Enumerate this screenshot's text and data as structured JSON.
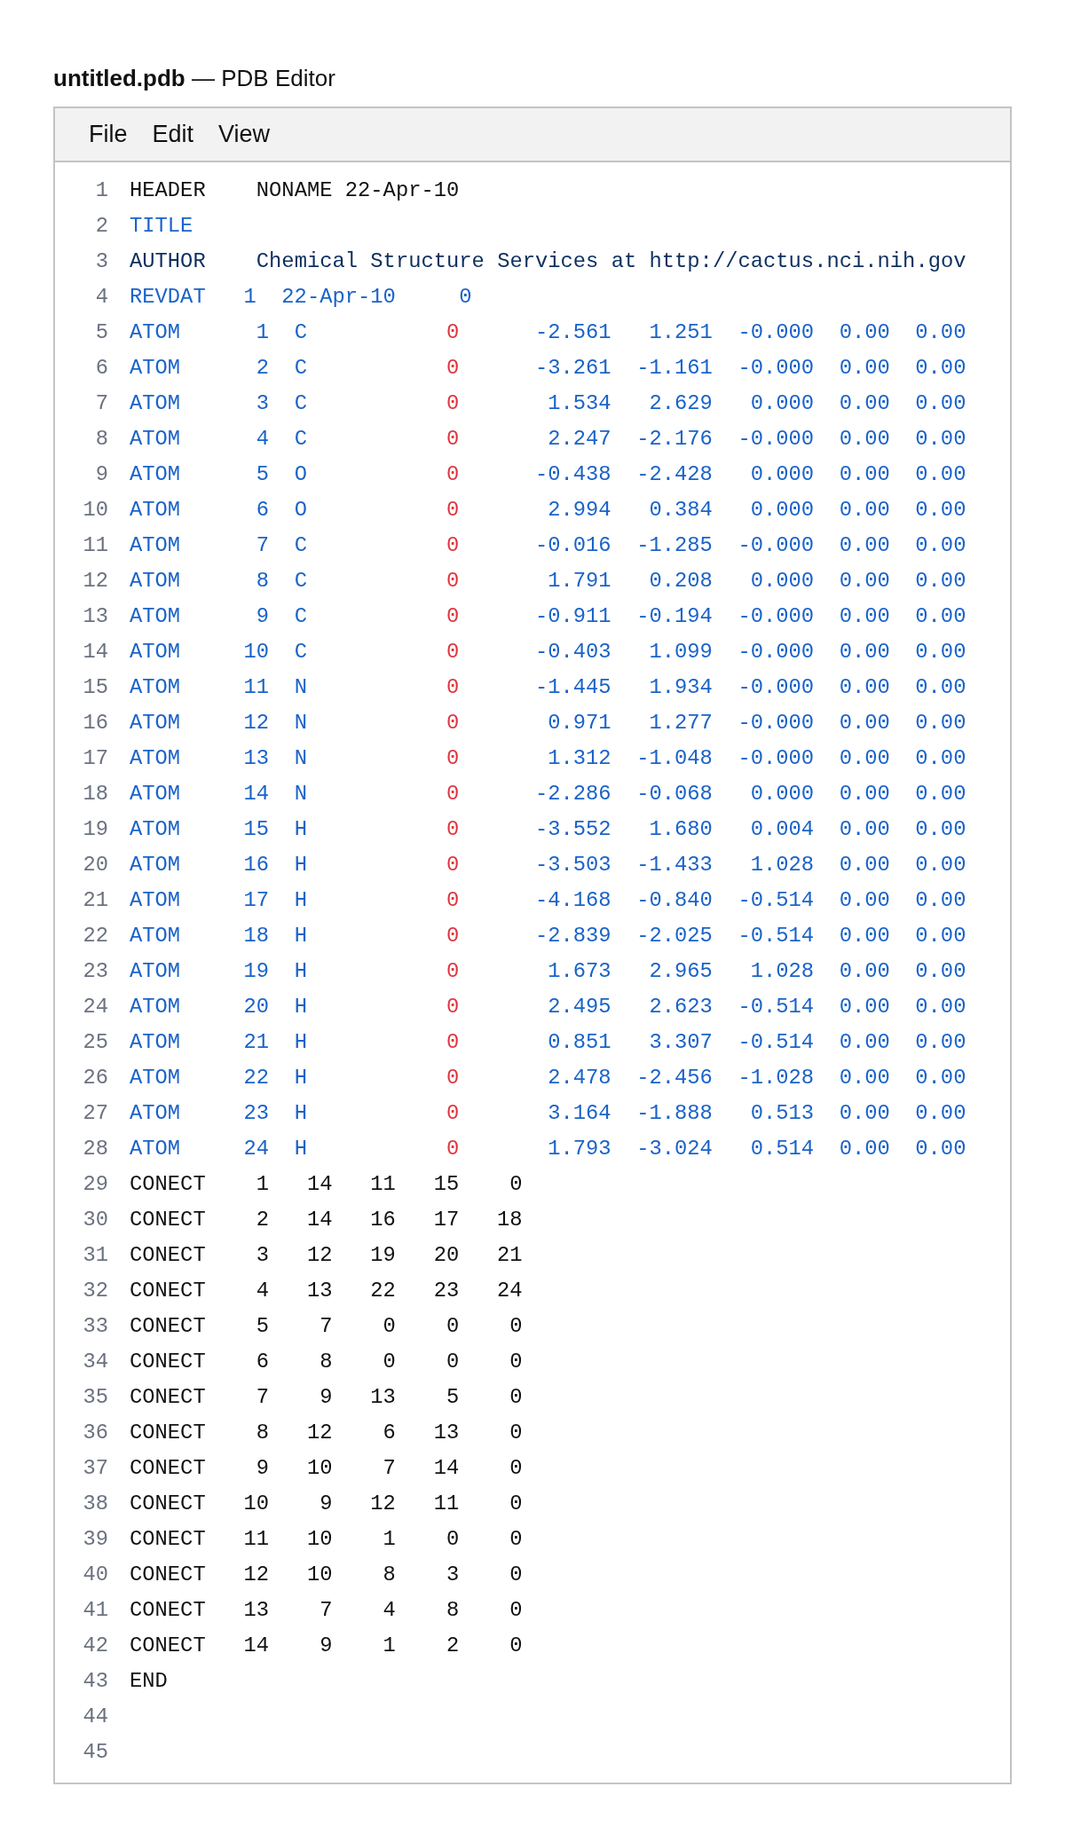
{
  "window": {
    "title": "**untitled.pdb** — PDB Editor"
  },
  "menu": [
    "File",
    "Edit",
    "View"
  ],
  "lines": [
    {
      "number": "1",
      "kind": "header",
      "fields": [
        "HEADER",
        "NONAME 22-Apr-10"
      ]
    },
    {
      "number": "2",
      "kind": "title",
      "fields": [
        "TITLE"
      ]
    },
    {
      "number": "3",
      "kind": "author",
      "fields": [
        "AUTHOR",
        "Chemical Structure Services at http://cactus.nci.nih.gov"
      ]
    },
    {
      "number": "4",
      "kind": "revdat",
      "fields": [
        "REVDAT",
        "1",
        "22-Apr-10",
        "0"
      ]
    },
    {
      "number": "5",
      "kind": "atom",
      "fields": [
        "ATOM",
        "1",
        "C",
        "0",
        "-2.561",
        "1.251",
        "-0.000",
        "0.00",
        "0.00"
      ]
    },
    {
      "number": "6",
      "kind": "atom",
      "fields": [
        "ATOM",
        "2",
        "C",
        "0",
        "-3.261",
        "-1.161",
        "-0.000",
        "0.00",
        "0.00"
      ]
    },
    {
      "number": "7",
      "kind": "atom",
      "fields": [
        "ATOM",
        "3",
        "C",
        "0",
        "1.534",
        "2.629",
        "0.000",
        "0.00",
        "0.00"
      ]
    },
    {
      "number": "8",
      "kind": "atom",
      "fields": [
        "ATOM",
        "4",
        "C",
        "0",
        "2.247",
        "-2.176",
        "-0.000",
        "0.00",
        "0.00"
      ]
    },
    {
      "number": "9",
      "kind": "atom",
      "fields": [
        "ATOM",
        "5",
        "O",
        "0",
        "-0.438",
        "-2.428",
        "0.000",
        "0.00",
        "0.00"
      ]
    },
    {
      "number": "10",
      "kind": "atom",
      "fields": [
        "ATOM",
        "6",
        "O",
        "0",
        "2.994",
        "0.384",
        "0.000",
        "0.00",
        "0.00"
      ]
    },
    {
      "number": "11",
      "kind": "atom",
      "fields": [
        "ATOM",
        "7",
        "C",
        "0",
        "-0.016",
        "-1.285",
        "-0.000",
        "0.00",
        "0.00"
      ]
    },
    {
      "number": "12",
      "kind": "atom",
      "fields": [
        "ATOM",
        "8",
        "C",
        "0",
        "1.791",
        "0.208",
        "0.000",
        "0.00",
        "0.00"
      ]
    },
    {
      "number": "13",
      "kind": "atom",
      "fields": [
        "ATOM",
        "9",
        "C",
        "0",
        "-0.911",
        "-0.194",
        "-0.000",
        "0.00",
        "0.00"
      ]
    },
    {
      "number": "14",
      "kind": "atom",
      "fields": [
        "ATOM",
        "10",
        "C",
        "0",
        "-0.403",
        "1.099",
        "-0.000",
        "0.00",
        "0.00"
      ]
    },
    {
      "number": "15",
      "kind": "atom",
      "fields": [
        "ATOM",
        "11",
        "N",
        "0",
        "-1.445",
        "1.934",
        "-0.000",
        "0.00",
        "0.00"
      ]
    },
    {
      "number": "16",
      "kind": "atom",
      "fields": [
        "ATOM",
        "12",
        "N",
        "0",
        "0.971",
        "1.277",
        "-0.000",
        "0.00",
        "0.00"
      ]
    },
    {
      "number": "17",
      "kind": "atom",
      "fields": [
        "ATOM",
        "13",
        "N",
        "0",
        "1.312",
        "-1.048",
        "-0.000",
        "0.00",
        "0.00"
      ]
    },
    {
      "number": "18",
      "kind": "atom",
      "fields": [
        "ATOM",
        "14",
        "N",
        "0",
        "-2.286",
        "-0.068",
        "0.000",
        "0.00",
        "0.00"
      ]
    },
    {
      "number": "19",
      "kind": "atom",
      "fields": [
        "ATOM",
        "15",
        "H",
        "0",
        "-3.552",
        "1.680",
        "0.004",
        "0.00",
        "0.00"
      ]
    },
    {
      "number": "20",
      "kind": "atom",
      "fields": [
        "ATOM",
        "16",
        "H",
        "0",
        "-3.503",
        "-1.433",
        "1.028",
        "0.00",
        "0.00"
      ]
    },
    {
      "number": "21",
      "kind": "atom",
      "fields": [
        "ATOM",
        "17",
        "H",
        "0",
        "-4.168",
        "-0.840",
        "-0.514",
        "0.00",
        "0.00"
      ]
    },
    {
      "number": "22",
      "kind": "atom",
      "fields": [
        "ATOM",
        "18",
        "H",
        "0",
        "-2.839",
        "-2.025",
        "-0.514",
        "0.00",
        "0.00"
      ]
    },
    {
      "number": "23",
      "kind": "atom",
      "fields": [
        "ATOM",
        "19",
        "H",
        "0",
        "1.673",
        "2.965",
        "1.028",
        "0.00",
        "0.00"
      ]
    },
    {
      "number": "24",
      "kind": "atom",
      "fields": [
        "ATOM",
        "20",
        "H",
        "0",
        "2.495",
        "2.623",
        "-0.514",
        "0.00",
        "0.00"
      ]
    },
    {
      "number": "25",
      "kind": "atom",
      "fields": [
        "ATOM",
        "21",
        "H",
        "0",
        "0.851",
        "3.307",
        "-0.514",
        "0.00",
        "0.00"
      ]
    },
    {
      "number": "26",
      "kind": "atom",
      "fields": [
        "ATOM",
        "22",
        "H",
        "0",
        "2.478",
        "-2.456",
        "-1.028",
        "0.00",
        "0.00"
      ]
    },
    {
      "number": "27",
      "kind": "atom",
      "fields": [
        "ATOM",
        "23",
        "H",
        "0",
        "3.164",
        "-1.888",
        "0.513",
        "0.00",
        "0.00"
      ]
    },
    {
      "number": "28",
      "kind": "atom",
      "fields": [
        "ATOM",
        "24",
        "H",
        "0",
        "1.793",
        "-3.024",
        "0.514",
        "0.00",
        "0.00"
      ]
    },
    {
      "number": "29",
      "kind": "conect",
      "fields": [
        "CONECT",
        "1",
        "14",
        "11",
        "15",
        "0"
      ]
    },
    {
      "number": "30",
      "kind": "conect",
      "fields": [
        "CONECT",
        "2",
        "14",
        "16",
        "17",
        "18"
      ]
    },
    {
      "number": "31",
      "kind": "conect",
      "fields": [
        "CONECT",
        "3",
        "12",
        "19",
        "20",
        "21"
      ]
    },
    {
      "number": "32",
      "kind": "conect",
      "fields": [
        "CONECT",
        "4",
        "13",
        "22",
        "23",
        "24"
      ]
    },
    {
      "number": "33",
      "kind": "conect",
      "fields": [
        "CONECT",
        "5",
        "7",
        "0",
        "0",
        "0"
      ]
    },
    {
      "number": "34",
      "kind": "conect",
      "fields": [
        "CONECT",
        "6",
        "8",
        "0",
        "0",
        "0"
      ]
    },
    {
      "number": "35",
      "kind": "conect",
      "fields": [
        "CONECT",
        "7",
        "9",
        "13",
        "5",
        "0"
      ]
    },
    {
      "number": "36",
      "kind": "conect",
      "fields": [
        "CONECT",
        "8",
        "12",
        "6",
        "13",
        "0"
      ]
    },
    {
      "number": "37",
      "kind": "conect",
      "fields": [
        "CONECT",
        "9",
        "10",
        "7",
        "14",
        "0"
      ]
    },
    {
      "number": "38",
      "kind": "conect",
      "fields": [
        "CONECT",
        "10",
        "9",
        "12",
        "11",
        "0"
      ]
    },
    {
      "number": "39",
      "kind": "conect",
      "fields": [
        "CONECT",
        "11",
        "10",
        "1",
        "0",
        "0"
      ]
    },
    {
      "number": "40",
      "kind": "conect",
      "fields": [
        "CONECT",
        "12",
        "10",
        "8",
        "3",
        "0"
      ]
    },
    {
      "number": "41",
      "kind": "conect",
      "fields": [
        "CONECT",
        "13",
        "7",
        "4",
        "8",
        "0"
      ]
    },
    {
      "number": "42",
      "kind": "conect",
      "fields": [
        "CONECT",
        "14",
        "9",
        "1",
        "2",
        "0"
      ]
    },
    {
      "number": "43",
      "kind": "end",
      "fields": [
        "END"
      ]
    },
    {
      "number": "44",
      "kind": "blank"
    },
    {
      "number": "45",
      "kind": "blank"
    }
  ]
}
